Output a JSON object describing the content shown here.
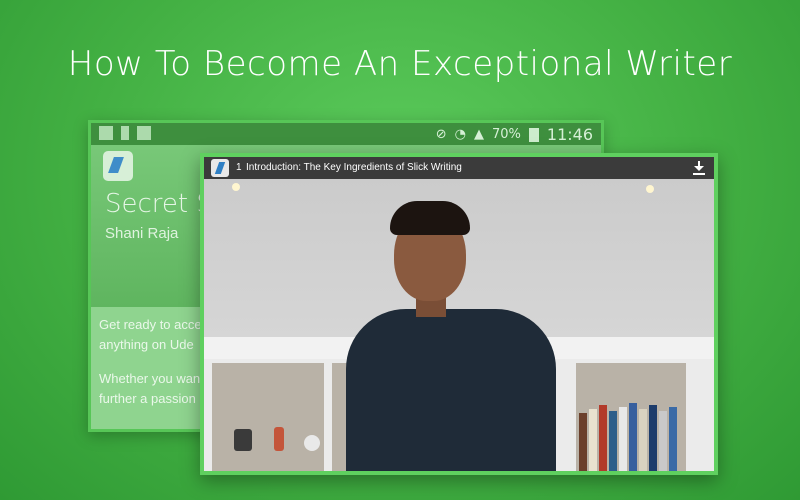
{
  "headline": "How To Become An Exceptional Writer",
  "back_screen": {
    "status_time": "11:46",
    "battery_percent": "70%",
    "title_partial": "Secret Sa",
    "author": "Shani Raja",
    "body_lines": [
      "Get ready to acce",
      "anything on Ude",
      "Whether you wan",
      "further a passion"
    ],
    "icons": [
      "gallery-icon",
      "notification-icon",
      "image-icon",
      "mute-icon",
      "wifi-icon",
      "signal-icon",
      "battery-icon"
    ]
  },
  "video": {
    "lecture_number": "1",
    "lecture_title": "Introduction: The Key Ingredients of Slick Writing",
    "icons": [
      "course-app-icon",
      "download-icon"
    ]
  },
  "colors": {
    "background": "#43b043",
    "panel_border": "#5fd05f",
    "titlebar": "#3b3b3b"
  }
}
